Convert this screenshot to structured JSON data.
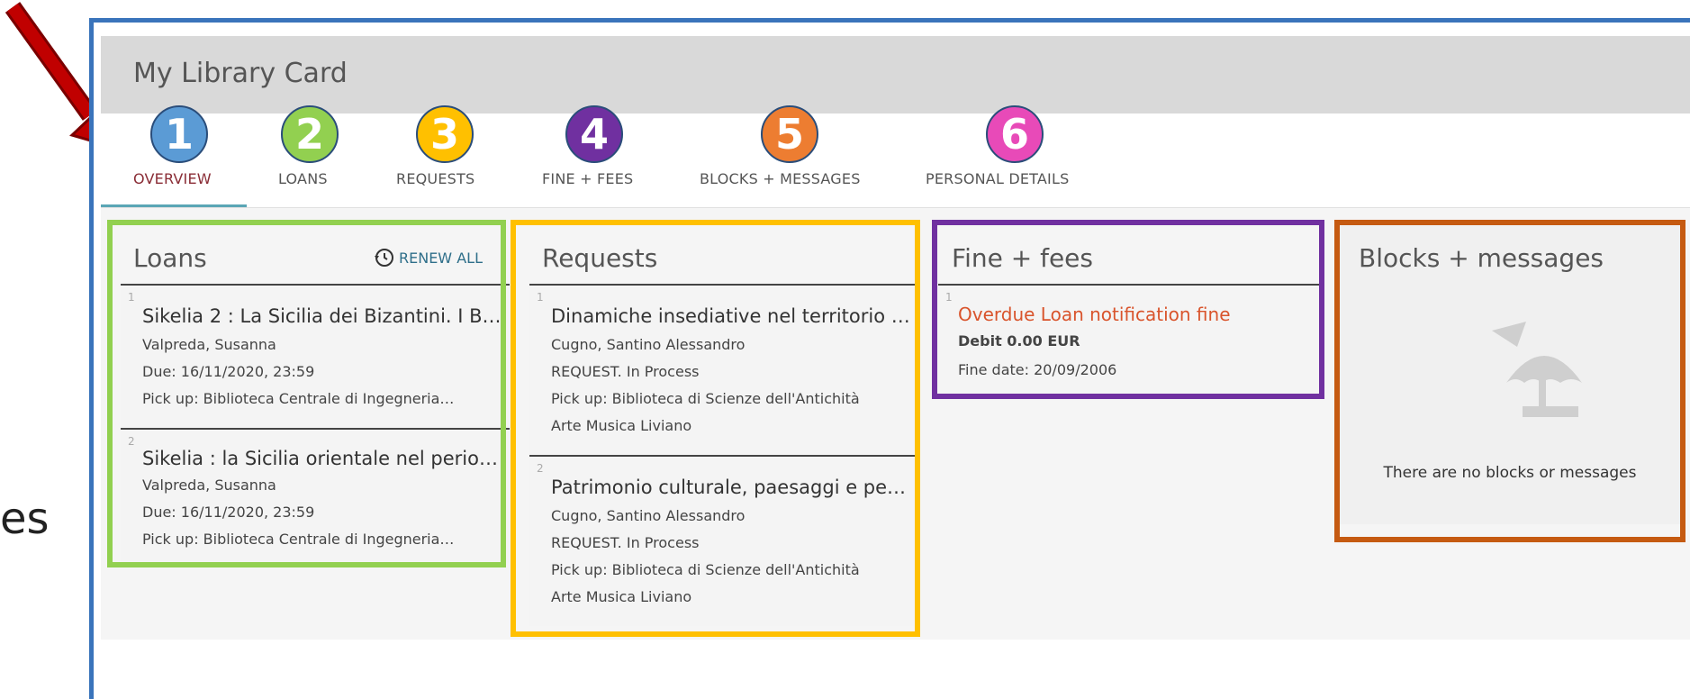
{
  "colors": {
    "frame": "#3a74bb",
    "badge1": "#5b9bd5",
    "badge2": "#92d050",
    "badge3": "#ffc000",
    "badge4": "#7030a0",
    "badge5": "#ed7d31",
    "badge6": "#e84ab8",
    "loans_box": "#92d050",
    "requests_box": "#ffc000",
    "fines_box": "#7030a0",
    "blocks_box": "#c55a11",
    "arrow": "#c00000",
    "fine_link": "#d9542c"
  },
  "app": {
    "title": "My Library Card"
  },
  "left_fragment": "es",
  "tabs": [
    {
      "label": "OVERVIEW",
      "badge": "1"
    },
    {
      "label": "LOANS",
      "badge": "2"
    },
    {
      "label": "REQUESTS",
      "badge": "3"
    },
    {
      "label": "FINE + FEES",
      "badge": "4"
    },
    {
      "label": "BLOCKS + MESSAGES",
      "badge": "5"
    },
    {
      "label": "PERSONAL DETAILS",
      "badge": "6"
    }
  ],
  "loans": {
    "title": "Loans",
    "renew_all": "RENEW ALL",
    "renew_icon": "clock-renew-icon",
    "items": [
      {
        "index": "1",
        "title": "Sikelia 2 : La Sicilia dei Bizantini. I Bi…",
        "author": "Valpreda, Susanna",
        "due": "Due: 16/11/2020, 23:59",
        "pickup": "Pick up: Biblioteca Centrale di Ingegneria…"
      },
      {
        "index": "2",
        "title": "Sikelia : la Sicilia orientale nel perio…",
        "author": "Valpreda, Susanna",
        "due": "Due: 16/11/2020, 23:59",
        "pickup": "Pick up: Biblioteca Centrale di Ingegneria…"
      }
    ]
  },
  "requests": {
    "title": "Requests",
    "items": [
      {
        "index": "1",
        "title": "Dinamiche insediative nel territorio …",
        "author": "Cugno, Santino Alessandro",
        "status": "REQUEST. In Process",
        "pickup": "Pick up: Biblioteca di Scienze dell'Antichità",
        "pickup2": "Arte Musica Liviano"
      },
      {
        "index": "2",
        "title": "Patrimonio culturale, paesaggi e pe…",
        "author": "Cugno, Santino Alessandro",
        "status": "REQUEST. In Process",
        "pickup": "Pick up: Biblioteca di Scienze dell'Antichità",
        "pickup2": "Arte Musica Liviano"
      }
    ]
  },
  "fines": {
    "title": "Fine + fees",
    "items": [
      {
        "index": "1",
        "title": "Overdue Loan notification fine",
        "amount": "Debit 0.00 EUR",
        "date": "Fine date: 20/09/2006"
      }
    ]
  },
  "blocks": {
    "title": "Blocks + messages",
    "icon": "beach-umbrella-icon",
    "empty_message": "There are no blocks or messages"
  }
}
